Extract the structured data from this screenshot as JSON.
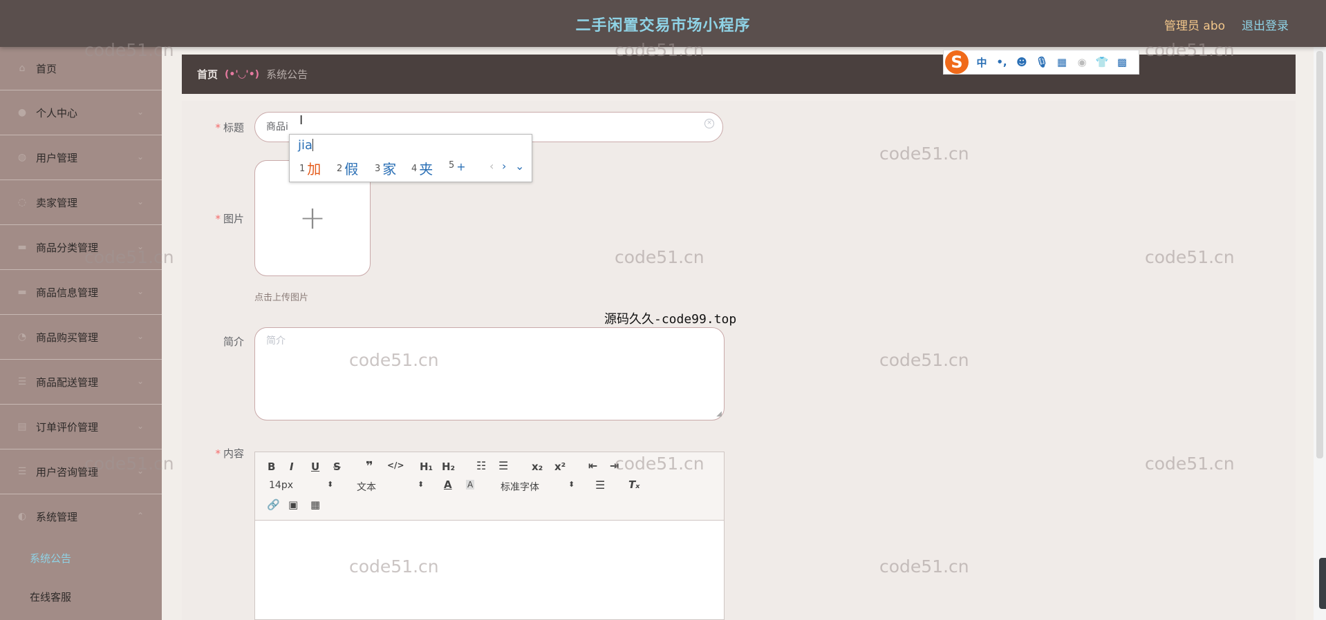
{
  "header": {
    "app_title": "二手闲置交易市场小程序",
    "admin_label": "管理员 abo",
    "logout_label": "退出登录"
  },
  "sidebar": {
    "items": [
      {
        "label": "首页",
        "icon": "home-icon"
      },
      {
        "label": "个人中心",
        "icon": "user-icon"
      },
      {
        "label": "用户管理",
        "icon": "users-icon"
      },
      {
        "label": "卖家管理",
        "icon": "seller-icon"
      },
      {
        "label": "商品分类管理",
        "icon": "category-icon"
      },
      {
        "label": "商品信息管理",
        "icon": "goods-icon"
      },
      {
        "label": "商品购买管理",
        "icon": "cart-icon"
      },
      {
        "label": "商品配送管理",
        "icon": "delivery-icon"
      },
      {
        "label": "订单评价管理",
        "icon": "review-icon"
      },
      {
        "label": "用户咨询管理",
        "icon": "consult-icon"
      },
      {
        "label": "系统管理",
        "icon": "system-icon"
      }
    ],
    "sub_items": [
      {
        "label": "系统公告",
        "active": true
      },
      {
        "label": "在线客服",
        "active": false
      }
    ]
  },
  "breadcrumb": {
    "home": "首页",
    "separator": "(•'◡'•)",
    "current": "系统公告"
  },
  "form": {
    "title_label": "标题",
    "title_value": "商品i",
    "image_label": "图片",
    "upload_hint": "点击上传图片",
    "intro_label": "简介",
    "intro_placeholder": "简介",
    "content_label": "内容"
  },
  "editor": {
    "font_size": "14px",
    "header_select": "文本",
    "font_family": "标准字体",
    "buttons": [
      "B",
      "I",
      "U",
      "S",
      "❞",
      "</>",
      "H₁",
      "H₂",
      "x₂",
      "x²",
      "Tₓ"
    ]
  },
  "ime": {
    "pinyin": "jia",
    "candidates": [
      {
        "num": "1",
        "text": "加"
      },
      {
        "num": "2",
        "text": "假"
      },
      {
        "num": "3",
        "text": "家"
      },
      {
        "num": "4",
        "text": "夹"
      },
      {
        "num": "5",
        "text": "+"
      }
    ],
    "toolbar": {
      "logo": "S",
      "mode": "中",
      "punct": "•,"
    }
  },
  "watermarks": {
    "site": "code51.cn",
    "source": "源码久久-code99.top"
  },
  "colors": {
    "header_bg": "#5a4f4d",
    "sidebar_bg": "#a28c87",
    "accent_cyan": "#8fd3e6",
    "accent_gold": "#f3c78b",
    "required_red": "#f56c6c"
  }
}
